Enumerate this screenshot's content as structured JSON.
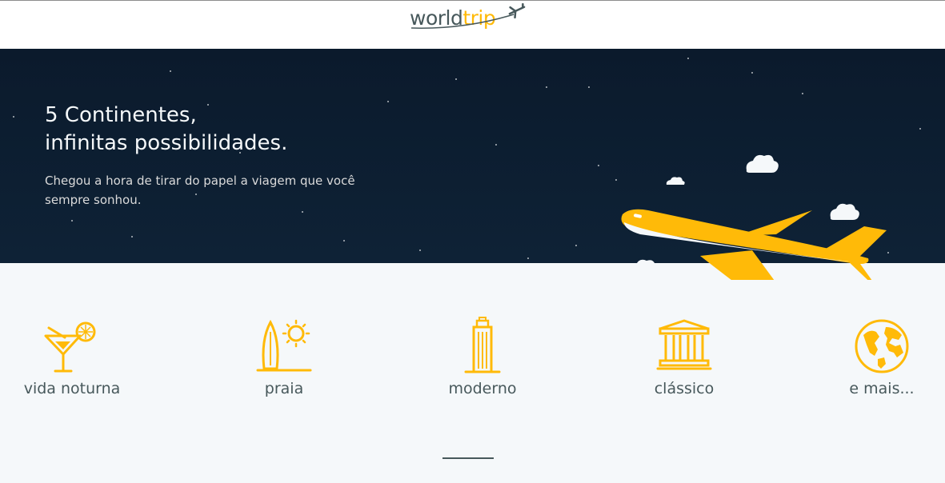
{
  "header": {
    "logo": {
      "word": "world",
      "accent": "trip",
      "icon": "airplane-icon"
    }
  },
  "banner": {
    "title_line1": "5 Continentes,",
    "title_line2": "infinitas possibilidades.",
    "subtitle": "Chegou a hora de tirar do papel a viagem que você sempre sonhou."
  },
  "travel_types": [
    {
      "label": "vida noturna",
      "icon": "cocktail-icon"
    },
    {
      "label": "praia",
      "icon": "surfboard-sun-icon"
    },
    {
      "label": "moderno",
      "icon": "skyscraper-icon"
    },
    {
      "label": "clássico",
      "icon": "temple-icon"
    },
    {
      "label": "e mais...",
      "icon": "globe-icon"
    }
  ],
  "colors": {
    "accent": "#ffba08",
    "text": "#47585b",
    "banner_bg": "#0e2236",
    "page_bg": "#f5f8fa"
  }
}
